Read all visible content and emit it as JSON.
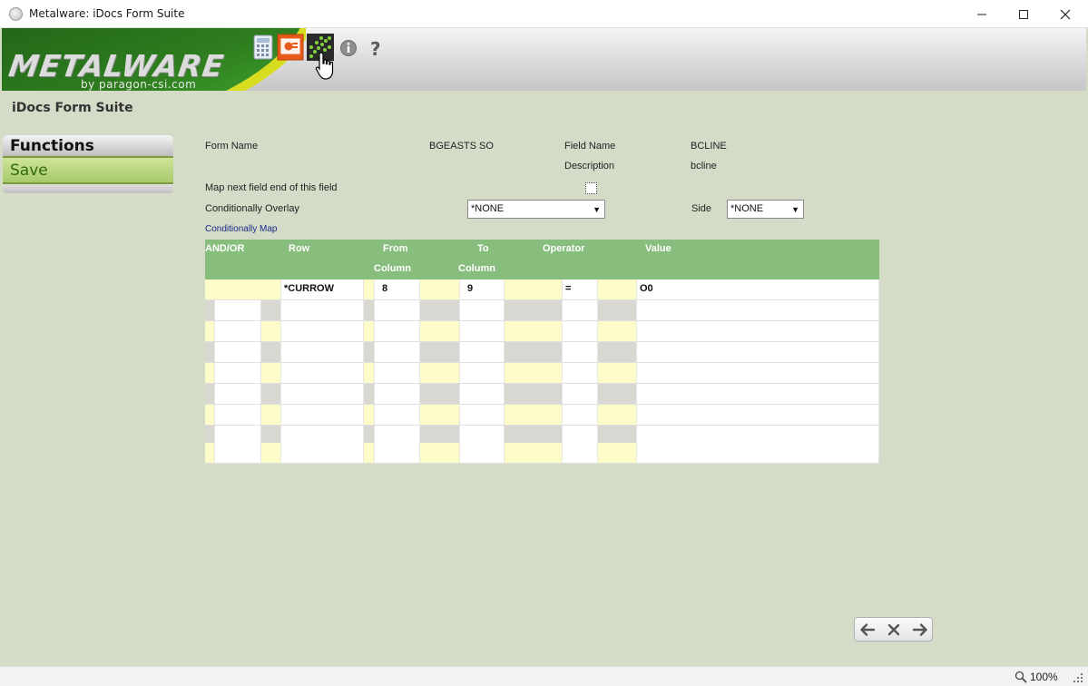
{
  "window": {
    "title": "Metalware: iDocs Form Suite"
  },
  "banner": {
    "logo_text": "METALWARE",
    "logo_sub": "by paragon-csi.com"
  },
  "page": {
    "title": "iDocs Form Suite"
  },
  "sidebar": {
    "header": "Functions",
    "items": [
      {
        "label": "Save"
      }
    ]
  },
  "form": {
    "form_name_label": "Form Name",
    "form_name_value": "BGEASTS SO",
    "field_name_label": "Field Name",
    "field_name_value": "BCLINE",
    "description_label": "Description",
    "description_value": "bcline",
    "map_next_label": "Map next field end of this field",
    "cond_overlay_label": "Conditionally Overlay",
    "cond_overlay_value": "*NONE",
    "side_label": "Side",
    "side_value": "*NONE",
    "cond_map_link": "Conditionally Map"
  },
  "grid": {
    "headers": [
      "AND/OR",
      "Row",
      "From",
      "Column",
      "To",
      "Column",
      "Operator",
      "Value"
    ],
    "first_row": {
      "row": "*CURROW",
      "from_column": "8",
      "to_column": "9",
      "operator": "=",
      "value": "O0"
    }
  },
  "status": {
    "zoom": "100%"
  }
}
